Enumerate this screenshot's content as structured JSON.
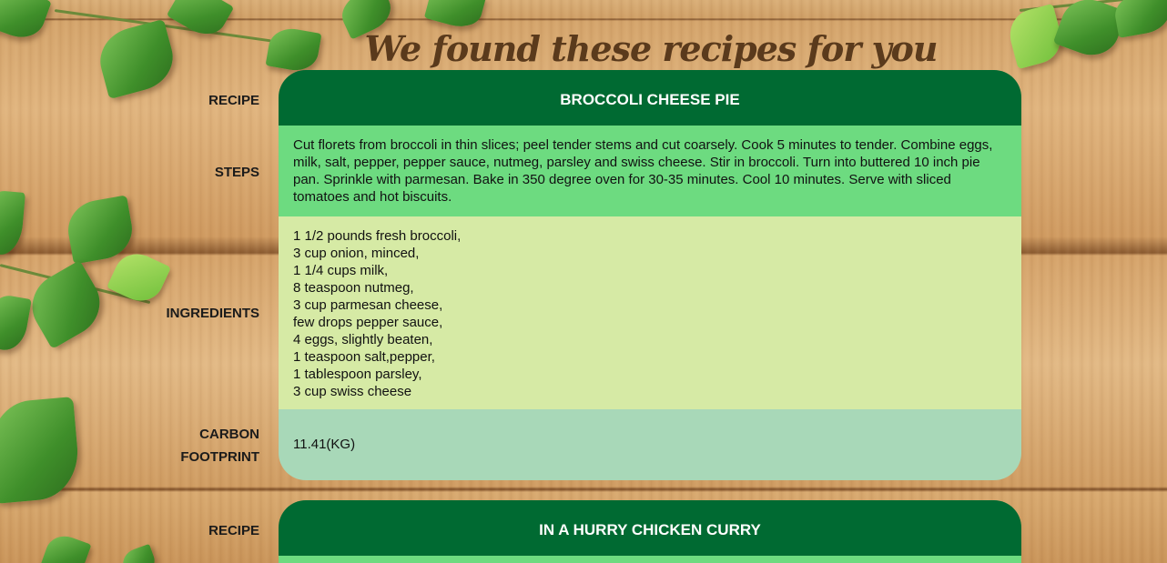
{
  "page": {
    "title": "We found these recipes for you"
  },
  "labels": {
    "recipe": "RECIPE",
    "steps": "STEPS",
    "ingredients": "INGREDIENTS",
    "carbon_line1": "CARBON",
    "carbon_line2": "FOOTPRINT"
  },
  "recipes": [
    {
      "name": "BROCCOLI CHEESE PIE",
      "steps": "Cut florets from broccoli in thin slices; peel tender stems and cut coarsely. Cook 5 minutes to tender. Combine eggs, milk, salt, pepper, pepper sauce, nutmeg, parsley and swiss cheese. Stir in broccoli. Turn into buttered 10 inch pie pan. Sprinkle with parmesan. Bake in 350 degree oven for 30-35 minutes. Cool 10 minutes. Serve with sliced tomatoes and hot biscuits.",
      "ingredients": [
        "1 1/2 pounds fresh broccoli,",
        "3 cup onion, minced,",
        "1 1/4 cups milk,",
        "8 teaspoon nutmeg,",
        "3 cup parmesan cheese,",
        "few drops pepper sauce,",
        "4 eggs, slightly beaten,",
        "1 teaspoon salt,pepper,",
        "1 tablespoon parsley,",
        "3 cup swiss cheese"
      ],
      "carbon_footprint": "11.41(KG)"
    },
    {
      "name": "IN A HURRY CHICKEN CURRY"
    }
  ],
  "colors": {
    "header": "#006a32",
    "steps_bg": "#6ddb80",
    "ingredients_bg": "#d6eaa5",
    "carbon_bg": "#a8d8b8",
    "title": "#5a3a1c"
  },
  "decor": {
    "background": "wood-planks",
    "ornament": "ivy-leaves"
  }
}
